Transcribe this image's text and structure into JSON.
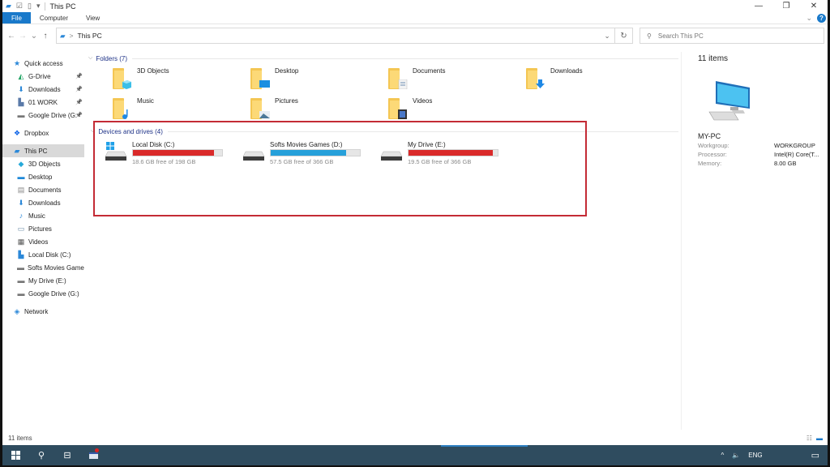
{
  "window": {
    "title": "This PC",
    "controls": {
      "minimize": "—",
      "maximize": "❐",
      "close": "✕"
    }
  },
  "ribbon": {
    "tabs": [
      "File",
      "Computer",
      "View"
    ],
    "expand_icon": "chevron-down-icon",
    "help_label": "?"
  },
  "nav": {
    "back": "←",
    "forward": "→",
    "recent": "⌄",
    "up": "↑",
    "address_sep": ">",
    "address": "This PC",
    "refresh": "↻",
    "search_placeholder": "Search This PC"
  },
  "sidebar": {
    "items": [
      {
        "label": "Quick access",
        "icon": "star-icon",
        "level": 1,
        "pinned": false
      },
      {
        "label": "G-Drive",
        "icon": "gdrive-icon",
        "level": 2,
        "pinned": true
      },
      {
        "label": "Downloads",
        "icon": "download-icon",
        "level": 2,
        "pinned": true
      },
      {
        "label": "01 WORK",
        "icon": "folder-user-icon",
        "level": 2,
        "pinned": true
      },
      {
        "label": "Google Drive (G:",
        "icon": "drive-icon",
        "level": 2,
        "pinned": true
      },
      {
        "label": "Dropbox",
        "icon": "dropbox-icon",
        "level": 1,
        "pinned": false
      },
      {
        "label": "This PC",
        "icon": "pc-icon",
        "level": 1,
        "selected": true
      },
      {
        "label": "3D Objects",
        "icon": "cube-icon",
        "level": 2
      },
      {
        "label": "Desktop",
        "icon": "desktop-icon",
        "level": 2
      },
      {
        "label": "Documents",
        "icon": "document-icon",
        "level": 2
      },
      {
        "label": "Downloads",
        "icon": "download-icon",
        "level": 2
      },
      {
        "label": "Music",
        "icon": "music-icon",
        "level": 2
      },
      {
        "label": "Pictures",
        "icon": "picture-icon",
        "level": 2
      },
      {
        "label": "Videos",
        "icon": "video-icon",
        "level": 2
      },
      {
        "label": "Local Disk (C:)",
        "icon": "system-drive-icon",
        "level": 2
      },
      {
        "label": "Softs Movies Games",
        "icon": "drive-icon",
        "level": 2
      },
      {
        "label": "My Drive (E:)",
        "icon": "drive-icon",
        "level": 2
      },
      {
        "label": "Google Drive (G:)",
        "icon": "drive-icon",
        "level": 2
      },
      {
        "label": "Network",
        "icon": "network-icon",
        "level": 1
      }
    ]
  },
  "folders": {
    "header": "Folders (7)",
    "items": [
      {
        "label": "3D Objects",
        "icon": "cube-icon"
      },
      {
        "label": "Desktop",
        "icon": "desktop-icon"
      },
      {
        "label": "Documents",
        "icon": "document-icon"
      },
      {
        "label": "Downloads",
        "icon": "download-icon"
      },
      {
        "label": "Music",
        "icon": "music-icon"
      },
      {
        "label": "Pictures",
        "icon": "picture-icon"
      },
      {
        "label": "Videos",
        "icon": "video-icon"
      }
    ]
  },
  "drives": {
    "header": "Devices and drives (4)",
    "items": [
      {
        "label": "Local Disk (C:)",
        "free": "18.6 GB free of 198 GB",
        "used_fraction": 0.906,
        "color": "#da2a2a",
        "system": true
      },
      {
        "label": "Softs Movies Games (D:)",
        "free": "57.5 GB free of 366 GB",
        "used_fraction": 0.843,
        "color": "#26a0da",
        "system": false
      },
      {
        "label": "My Drive (E:)",
        "free": "19.5 GB free of 366 GB",
        "used_fraction": 0.947,
        "color": "#da2a2a",
        "system": false
      }
    ]
  },
  "details": {
    "count": "11 items",
    "pc_name": "MY-PC",
    "props": [
      {
        "k": "Workgroup:",
        "v": "WORKGROUP"
      },
      {
        "k": "Processor:",
        "v": "Intel(R) Core(T..."
      },
      {
        "k": "Memory:",
        "v": "8.00 GB"
      }
    ]
  },
  "status": {
    "count": "11 items"
  },
  "taskbar": {
    "tray_chevron": "^",
    "volume": "🔈",
    "language": "ENG"
  },
  "colors": {
    "accent": "#1979ca",
    "highlight_box": "#c42b35",
    "taskbar": "#2f4c5f"
  }
}
